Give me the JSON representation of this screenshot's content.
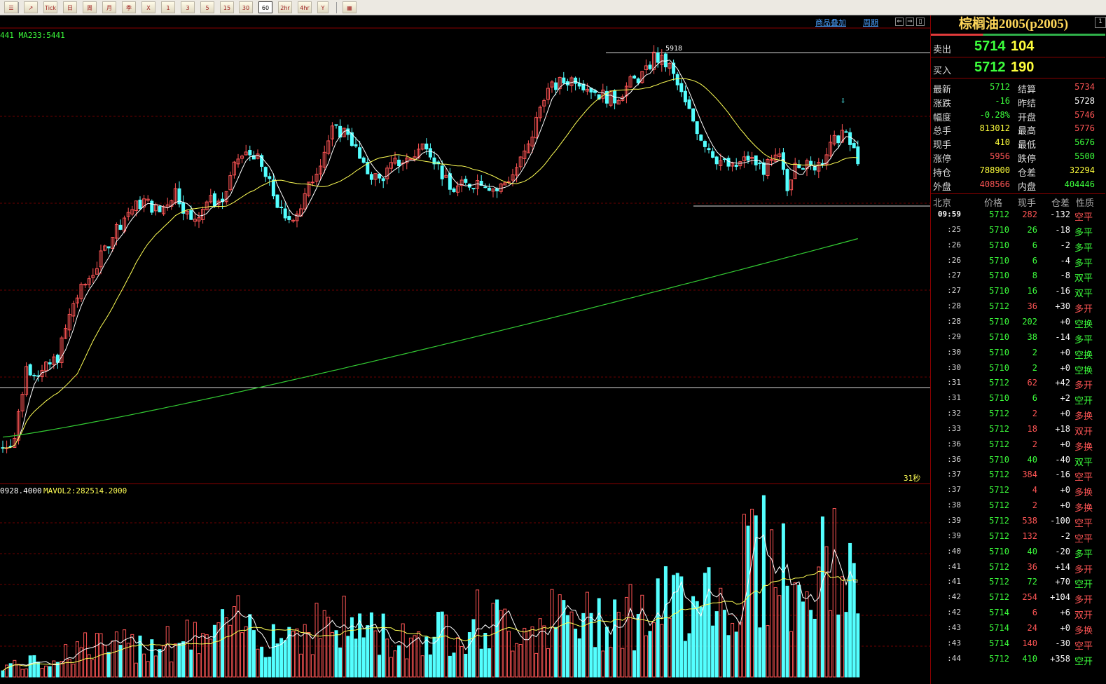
{
  "toolbar": {
    "buttons": [
      {
        "id": "list",
        "label": "☰"
      },
      {
        "id": "trend",
        "label": "↗"
      },
      {
        "id": "tick",
        "label": "Tick"
      },
      {
        "id": "day",
        "label": "日"
      },
      {
        "id": "week",
        "label": "周"
      },
      {
        "id": "month",
        "label": "月"
      },
      {
        "id": "quarter",
        "label": "季"
      },
      {
        "id": "year",
        "label": "X"
      },
      {
        "id": "m1",
        "label": "1"
      },
      {
        "id": "m3",
        "label": "3"
      },
      {
        "id": "m5",
        "label": "5"
      },
      {
        "id": "m15",
        "label": "15"
      },
      {
        "id": "m30",
        "label": "30"
      },
      {
        "id": "m60",
        "label": "60"
      },
      {
        "id": "h2",
        "label": "2hr"
      },
      {
        "id": "h4",
        "label": "4hr"
      },
      {
        "id": "custom",
        "label": "Y"
      },
      {
        "id": "calc",
        "label": "▦"
      }
    ],
    "selected": "60"
  },
  "chart_header": {
    "overlay_link": "商品叠加",
    "period_link": "周期",
    "ma_label": "441 MA233:5441",
    "high_label": "5918",
    "countdown": "31秒",
    "vol_label_prefix": "0928.4000",
    "vol_label_mavol": "MAVOL2:282514.2000"
  },
  "quote": {
    "title": "棕榈油2005(p2005)",
    "ask_label": "卖出",
    "ask_price": "5714",
    "ask_vol": "104",
    "bid_label": "买入",
    "bid_price": "5712",
    "bid_vol": "190",
    "stats": [
      {
        "k1": "最新",
        "v1": "5712",
        "c1": "#3cff3c",
        "k2": "结算",
        "v2": "5734",
        "c2": "#ff5555"
      },
      {
        "k1": "涨跌",
        "v1": "-16",
        "c1": "#3cff3c",
        "k2": "昨结",
        "v2": "5728",
        "c2": "#ffffff"
      },
      {
        "k1": "幅度",
        "v1": "-0.28%",
        "c1": "#3cff3c",
        "k2": "开盘",
        "v2": "5746",
        "c2": "#ff5555"
      },
      {
        "k1": "总手",
        "v1": "813012",
        "c1": "#ffff3c",
        "k2": "最高",
        "v2": "5776",
        "c2": "#ff5555"
      },
      {
        "k1": "现手",
        "v1": "410",
        "c1": "#ffff3c",
        "k2": "最低",
        "v2": "5676",
        "c2": "#3cff3c"
      },
      {
        "k1": "涨停",
        "v1": "5956",
        "c1": "#ff5555",
        "k2": "跌停",
        "v2": "5500",
        "c2": "#3cff3c"
      },
      {
        "k1": "持仓",
        "v1": "788900",
        "c1": "#ffff3c",
        "k2": "仓差",
        "v2": "32294",
        "c2": "#ffff3c"
      },
      {
        "k1": "外盘",
        "v1": "408566",
        "c1": "#ff5555",
        "k2": "内盘",
        "v2": "404446",
        "c2": "#3cff3c"
      }
    ],
    "table_headers": [
      "北京",
      "价格",
      "现手",
      "仓差",
      "性质"
    ],
    "ticks": [
      {
        "t": "09:59",
        "p": "5712",
        "v": "282",
        "vc": "#ff5555",
        "d": "-132",
        "n": "空平",
        "nc": "#ff5555"
      },
      {
        "t": ":25",
        "p": "5710",
        "v": "26",
        "vc": "#3cff3c",
        "d": "-18",
        "n": "多平",
        "nc": "#3cff3c"
      },
      {
        "t": ":26",
        "p": "5710",
        "v": "6",
        "vc": "#3cff3c",
        "d": "-2",
        "n": "多平",
        "nc": "#3cff3c"
      },
      {
        "t": ":26",
        "p": "5710",
        "v": "6",
        "vc": "#3cff3c",
        "d": "-4",
        "n": "多平",
        "nc": "#3cff3c"
      },
      {
        "t": ":27",
        "p": "5710",
        "v": "8",
        "vc": "#3cff3c",
        "d": "-8",
        "n": "双平",
        "nc": "#3cff3c"
      },
      {
        "t": ":27",
        "p": "5710",
        "v": "16",
        "vc": "#3cff3c",
        "d": "-16",
        "n": "双平",
        "nc": "#3cff3c"
      },
      {
        "t": ":28",
        "p": "5712",
        "v": "36",
        "vc": "#ff5555",
        "d": "+30",
        "n": "多开",
        "nc": "#ff5555"
      },
      {
        "t": ":28",
        "p": "5710",
        "v": "202",
        "vc": "#3cff3c",
        "d": "+0",
        "n": "空换",
        "nc": "#3cff3c"
      },
      {
        "t": ":29",
        "p": "5710",
        "v": "38",
        "vc": "#3cff3c",
        "d": "-14",
        "n": "多平",
        "nc": "#3cff3c"
      },
      {
        "t": ":30",
        "p": "5710",
        "v": "2",
        "vc": "#3cff3c",
        "d": "+0",
        "n": "空换",
        "nc": "#3cff3c"
      },
      {
        "t": ":30",
        "p": "5710",
        "v": "2",
        "vc": "#3cff3c",
        "d": "+0",
        "n": "空换",
        "nc": "#3cff3c"
      },
      {
        "t": ":31",
        "p": "5712",
        "v": "62",
        "vc": "#ff5555",
        "d": "+42",
        "n": "多开",
        "nc": "#ff5555"
      },
      {
        "t": ":31",
        "p": "5710",
        "v": "6",
        "vc": "#3cff3c",
        "d": "+2",
        "n": "空开",
        "nc": "#3cff3c"
      },
      {
        "t": ":32",
        "p": "5712",
        "v": "2",
        "vc": "#ff5555",
        "d": "+0",
        "n": "多换",
        "nc": "#ff5555"
      },
      {
        "t": ":33",
        "p": "5712",
        "v": "18",
        "vc": "#ff5555",
        "d": "+18",
        "n": "双开",
        "nc": "#ff5555"
      },
      {
        "t": ":36",
        "p": "5712",
        "v": "2",
        "vc": "#ff5555",
        "d": "+0",
        "n": "多换",
        "nc": "#ff5555"
      },
      {
        "t": ":36",
        "p": "5710",
        "v": "40",
        "vc": "#3cff3c",
        "d": "-40",
        "n": "双平",
        "nc": "#3cff3c"
      },
      {
        "t": ":37",
        "p": "5712",
        "v": "384",
        "vc": "#ff5555",
        "d": "-16",
        "n": "空平",
        "nc": "#ff5555"
      },
      {
        "t": ":37",
        "p": "5712",
        "v": "4",
        "vc": "#ff5555",
        "d": "+0",
        "n": "多换",
        "nc": "#ff5555"
      },
      {
        "t": ":38",
        "p": "5712",
        "v": "2",
        "vc": "#ff5555",
        "d": "+0",
        "n": "多换",
        "nc": "#ff5555"
      },
      {
        "t": ":39",
        "p": "5712",
        "v": "538",
        "vc": "#ff5555",
        "d": "-100",
        "n": "空平",
        "nc": "#ff5555"
      },
      {
        "t": ":39",
        "p": "5712",
        "v": "132",
        "vc": "#ff5555",
        "d": "-2",
        "n": "空平",
        "nc": "#ff5555"
      },
      {
        "t": ":40",
        "p": "5710",
        "v": "40",
        "vc": "#3cff3c",
        "d": "-20",
        "n": "多平",
        "nc": "#3cff3c"
      },
      {
        "t": ":41",
        "p": "5712",
        "v": "36",
        "vc": "#ff5555",
        "d": "+14",
        "n": "多开",
        "nc": "#ff5555"
      },
      {
        "t": ":41",
        "p": "5712",
        "v": "72",
        "vc": "#3cff3c",
        "d": "+70",
        "n": "空开",
        "nc": "#3cff3c"
      },
      {
        "t": ":42",
        "p": "5712",
        "v": "254",
        "vc": "#ff5555",
        "d": "+104",
        "n": "多开",
        "nc": "#ff5555"
      },
      {
        "t": ":42",
        "p": "5714",
        "v": "6",
        "vc": "#ff5555",
        "d": "+6",
        "n": "双开",
        "nc": "#ff5555"
      },
      {
        "t": ":43",
        "p": "5714",
        "v": "24",
        "vc": "#ff5555",
        "d": "+0",
        "n": "多换",
        "nc": "#ff5555"
      },
      {
        "t": ":43",
        "p": "5714",
        "v": "140",
        "vc": "#ff5555",
        "d": "-30",
        "n": "空平",
        "nc": "#ff5555"
      },
      {
        "t": ":44",
        "p": "5712",
        "v": "410",
        "vc": "#3cff3c",
        "d": "+358",
        "n": "空开",
        "nc": "#3cff3c"
      }
    ]
  },
  "chart_data": {
    "type": "candlestick",
    "up_color": "#ff5555",
    "down_color": "#54ffff",
    "ma_short_color": "#ffffff",
    "ma_mid_color": "#ffff55",
    "ma233_color": "#33cc33",
    "price_ylim": [
      5150,
      5960
    ],
    "anchors_price": [
      [
        0,
        5180
      ],
      [
        3,
        5200
      ],
      [
        6,
        5330
      ],
      [
        10,
        5320
      ],
      [
        14,
        5350
      ],
      [
        18,
        5450
      ],
      [
        24,
        5520
      ],
      [
        28,
        5580
      ],
      [
        32,
        5620
      ],
      [
        36,
        5640
      ],
      [
        40,
        5620
      ],
      [
        44,
        5660
      ],
      [
        48,
        5600
      ],
      [
        52,
        5640
      ],
      [
        56,
        5640
      ],
      [
        60,
        5720
      ],
      [
        64,
        5730
      ],
      [
        68,
        5670
      ],
      [
        72,
        5600
      ],
      [
        76,
        5630
      ],
      [
        80,
        5700
      ],
      [
        84,
        5770
      ],
      [
        88,
        5770
      ],
      [
        92,
        5700
      ],
      [
        96,
        5680
      ],
      [
        100,
        5710
      ],
      [
        104,
        5720
      ],
      [
        108,
        5750
      ],
      [
        114,
        5660
      ],
      [
        118,
        5670
      ],
      [
        122,
        5680
      ],
      [
        126,
        5660
      ],
      [
        130,
        5690
      ],
      [
        134,
        5740
      ],
      [
        138,
        5840
      ],
      [
        142,
        5860
      ],
      [
        146,
        5870
      ],
      [
        152,
        5840
      ],
      [
        156,
        5830
      ],
      [
        160,
        5860
      ],
      [
        164,
        5880
      ],
      [
        166,
        5910
      ],
      [
        170,
        5890
      ],
      [
        174,
        5820
      ],
      [
        178,
        5760
      ],
      [
        182,
        5720
      ],
      [
        186,
        5700
      ],
      [
        190,
        5720
      ],
      [
        194,
        5700
      ],
      [
        198,
        5720
      ],
      [
        200,
        5660
      ],
      [
        202,
        5720
      ],
      [
        206,
        5700
      ],
      [
        210,
        5730
      ],
      [
        214,
        5770
      ],
      [
        218,
        5720
      ]
    ],
    "anchors_vol": [
      [
        0,
        40
      ],
      [
        10,
        50
      ],
      [
        20,
        110
      ],
      [
        30,
        100
      ],
      [
        40,
        130
      ],
      [
        50,
        130
      ],
      [
        60,
        180
      ],
      [
        70,
        150
      ],
      [
        80,
        180
      ],
      [
        90,
        180
      ],
      [
        100,
        130
      ],
      [
        110,
        150
      ],
      [
        120,
        200
      ],
      [
        130,
        170
      ],
      [
        140,
        200
      ],
      [
        150,
        190
      ],
      [
        155,
        240
      ],
      [
        160,
        220
      ],
      [
        165,
        210
      ],
      [
        170,
        250
      ],
      [
        175,
        280
      ],
      [
        178,
        420
      ],
      [
        180,
        310
      ],
      [
        185,
        250
      ],
      [
        188,
        300
      ],
      [
        190,
        480
      ],
      [
        195,
        380
      ],
      [
        198,
        520
      ],
      [
        200,
        260
      ],
      [
        205,
        290
      ],
      [
        210,
        380
      ],
      [
        212,
        420
      ],
      [
        218,
        300
      ]
    ],
    "vol_ylim": [
      0,
      540
    ],
    "high_mark": 5918
  }
}
